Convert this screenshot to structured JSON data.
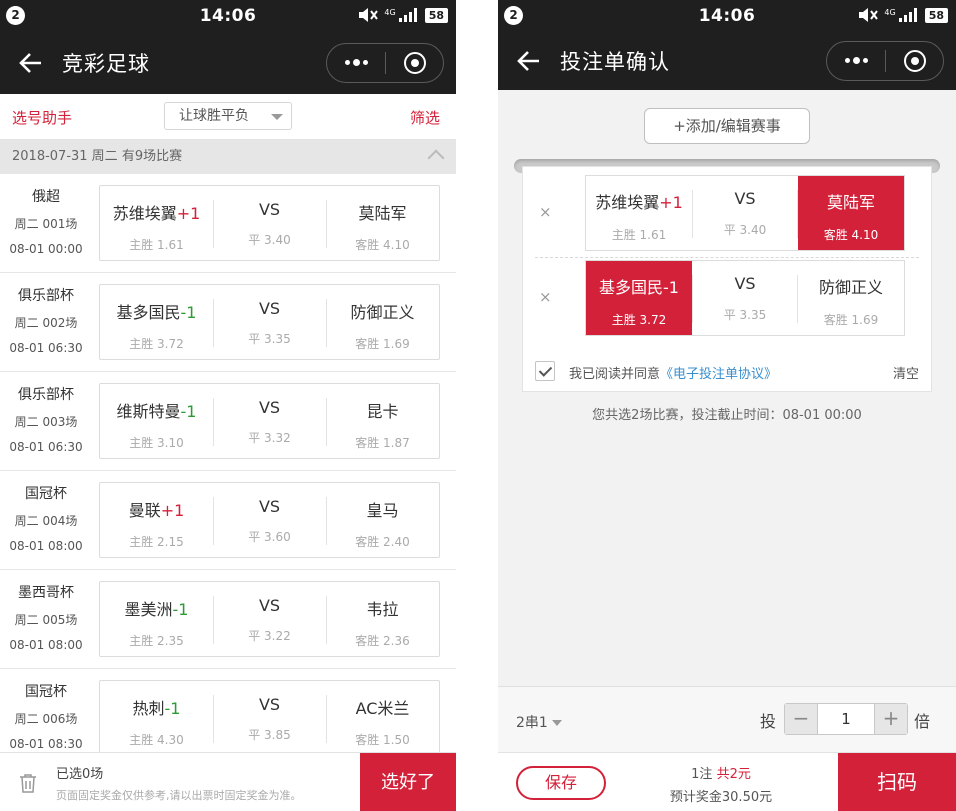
{
  "colors": {
    "accent": "#d4213a",
    "header_bg": "#1f1f1f",
    "link_blue": "#3a8fcf",
    "handicap_neg": "#2b9b36"
  },
  "status_bar": {
    "badge": "2",
    "time": "14:06",
    "network": "4G",
    "battery": "58"
  },
  "left": {
    "title": "竞彩足球",
    "helper_label": "选号助手",
    "play_type": "让球胜平负",
    "filter_label": "筛选",
    "date_header": "2018-07-31 周二 有9场比赛",
    "matches": [
      {
        "league": "俄超",
        "match_no": "周二 001场",
        "time": "08-01 00:00",
        "home": "苏维埃翼",
        "handicap": "+1",
        "vs": "VS",
        "away": "莫陆军",
        "home_odds": "主胜 1.61",
        "draw_odds": "平 3.40",
        "away_odds": "客胜 4.10"
      },
      {
        "league": "俱乐部杯",
        "match_no": "周二 002场",
        "time": "08-01 06:30",
        "home": "基多国民",
        "handicap": "-1",
        "vs": "VS",
        "away": "防御正义",
        "home_odds": "主胜 3.72",
        "draw_odds": "平 3.35",
        "away_odds": "客胜 1.69"
      },
      {
        "league": "俱乐部杯",
        "match_no": "周二 003场",
        "time": "08-01 06:30",
        "home": "维斯特曼",
        "handicap": "-1",
        "vs": "VS",
        "away": "昆卡",
        "home_odds": "主胜 3.10",
        "draw_odds": "平 3.32",
        "away_odds": "客胜 1.87"
      },
      {
        "league": "国冠杯",
        "match_no": "周二 004场",
        "time": "08-01 08:00",
        "home": "曼联",
        "handicap": "+1",
        "vs": "VS",
        "away": "皇马",
        "home_odds": "主胜 2.15",
        "draw_odds": "平 3.60",
        "away_odds": "客胜 2.40"
      },
      {
        "league": "墨西哥杯",
        "match_no": "周二 005场",
        "time": "08-01 08:00",
        "home": "墨美洲",
        "handicap": "-1",
        "vs": "VS",
        "away": "韦拉",
        "home_odds": "主胜 2.35",
        "draw_odds": "平 3.22",
        "away_odds": "客胜 2.36"
      },
      {
        "league": "国冠杯",
        "match_no": "周二 006场",
        "time": "08-01 08:30",
        "home": "热刺",
        "handicap": "-1",
        "vs": "VS",
        "away": "AC米兰",
        "home_odds": "主胜 4.30",
        "draw_odds": "平 3.85",
        "away_odds": "客胜 1.50"
      }
    ],
    "footer": {
      "selected": "已选0场",
      "note": "页面固定奖金仅供参考,请以出票时固定奖金为准。",
      "done_label": "选好了"
    }
  },
  "right": {
    "title": "投注单确认",
    "add_label": "+添加/编辑赛事",
    "remove_symbol": "×",
    "tickets": [
      {
        "home": "苏维埃翼",
        "handicap": "+1",
        "vs": "VS",
        "away": "莫陆军",
        "home_odds": "主胜 1.61",
        "draw_odds": "平 3.40",
        "away_odds": "客胜 4.10",
        "selected": "away"
      },
      {
        "home": "基多国民",
        "handicap": "-1",
        "vs": "VS",
        "away": "防御正义",
        "home_odds": "主胜 3.72",
        "draw_odds": "平 3.35",
        "away_odds": "客胜 1.69",
        "selected": "home"
      }
    ],
    "agree_text": "我已阅读并同意",
    "agree_link": "《电子投注单协议》",
    "clear_label": "清空",
    "summary": "您共选2场比赛，投注截止时间：08-01 00:00",
    "combo": "2串1",
    "bet_label": "投",
    "minus": "−",
    "multiplier": "1",
    "plus": "+",
    "times_label": "倍",
    "footer": {
      "save_label": "保存",
      "bets_prefix": "1注 ",
      "bets_total": "共2元",
      "prize": "预计奖金30.50元",
      "scan_label": "扫码"
    }
  }
}
